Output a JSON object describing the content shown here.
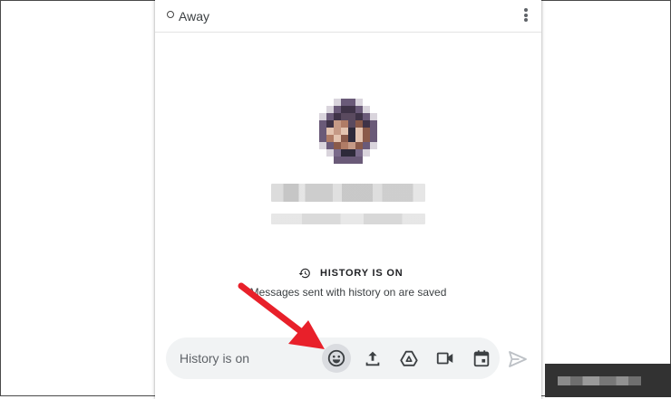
{
  "header": {
    "status": "Away",
    "menu_icon": "more-vert-icon"
  },
  "history": {
    "title": "HISTORY IS ON",
    "subtitle": "Messages sent with history on are saved",
    "icon": "history-icon"
  },
  "composer": {
    "placeholder": "History is on",
    "actions": [
      {
        "name": "emoji",
        "icon": "smiley-icon"
      },
      {
        "name": "upload",
        "icon": "upload-icon"
      },
      {
        "name": "drive",
        "icon": "drive-icon"
      },
      {
        "name": "video",
        "icon": "video-camera-icon"
      },
      {
        "name": "calendar",
        "icon": "calendar-icon"
      }
    ],
    "send_icon": "send-icon"
  },
  "colors": {
    "annotation_arrow": "#e8202a",
    "icon": "#5f6368",
    "composer_bg": "#f1f3f4",
    "toast_bg": "#323232"
  }
}
